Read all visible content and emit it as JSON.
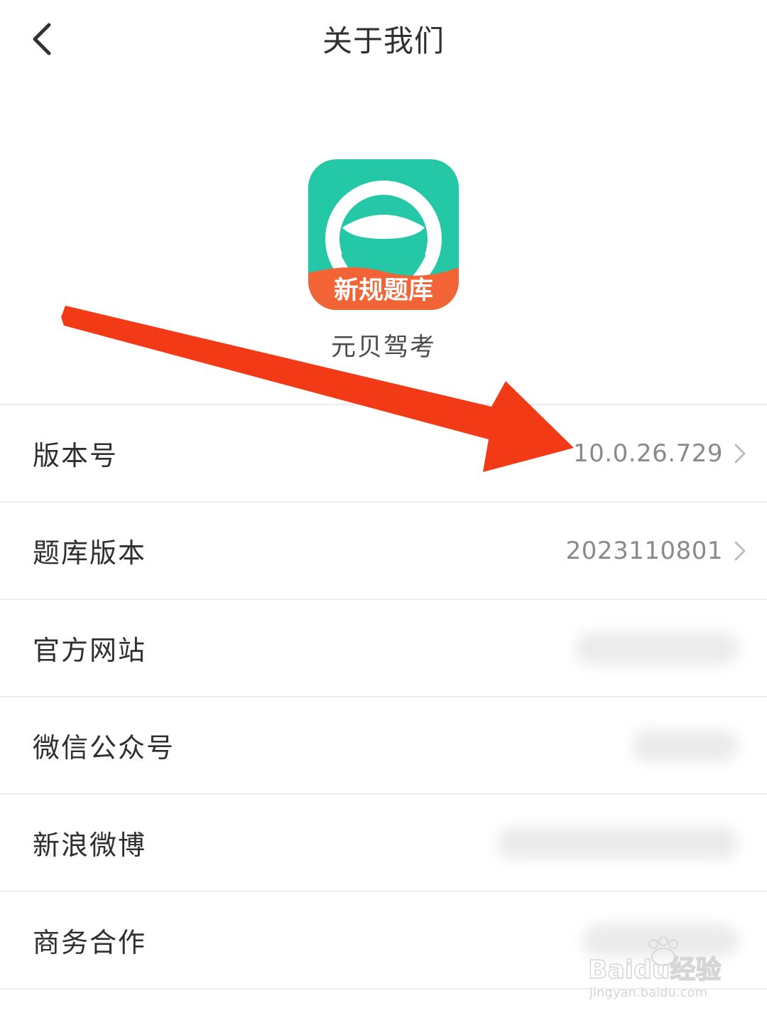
{
  "header": {
    "title": "关于我们",
    "back_icon": "chevron-left-icon"
  },
  "app": {
    "icon_badge": "新规题库",
    "name": "元贝驾考",
    "icon_colors": {
      "top": "#24c7a6",
      "bottom": "#f26436"
    }
  },
  "settings": {
    "items": [
      {
        "label": "版本号",
        "value": "10.0.26.729"
      },
      {
        "label": "题库版本",
        "value": "2023110801"
      },
      {
        "label": "官方网站",
        "value": ""
      },
      {
        "label": "微信公众号",
        "value": ""
      },
      {
        "label": "新浪微博",
        "value": ""
      },
      {
        "label": "商务合作",
        "value": ""
      }
    ]
  },
  "annotation": {
    "arrow_color": "#f23a17"
  },
  "watermark": {
    "brand": "Baidu经验",
    "url": "jingyan.baidu.com"
  }
}
